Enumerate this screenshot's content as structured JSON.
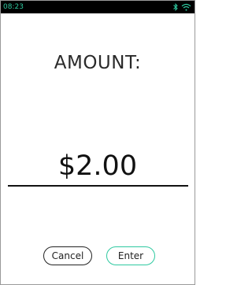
{
  "status_bar": {
    "time": "08:23",
    "icons": [
      "bluetooth-icon",
      "wifi-icon"
    ],
    "accent_color": "#2ec9a0"
  },
  "main": {
    "label": "AMOUNT:",
    "value": "$2.00"
  },
  "buttons": {
    "cancel_label": "Cancel",
    "enter_label": "Enter",
    "enter_border_color": "#2ec9a0"
  }
}
